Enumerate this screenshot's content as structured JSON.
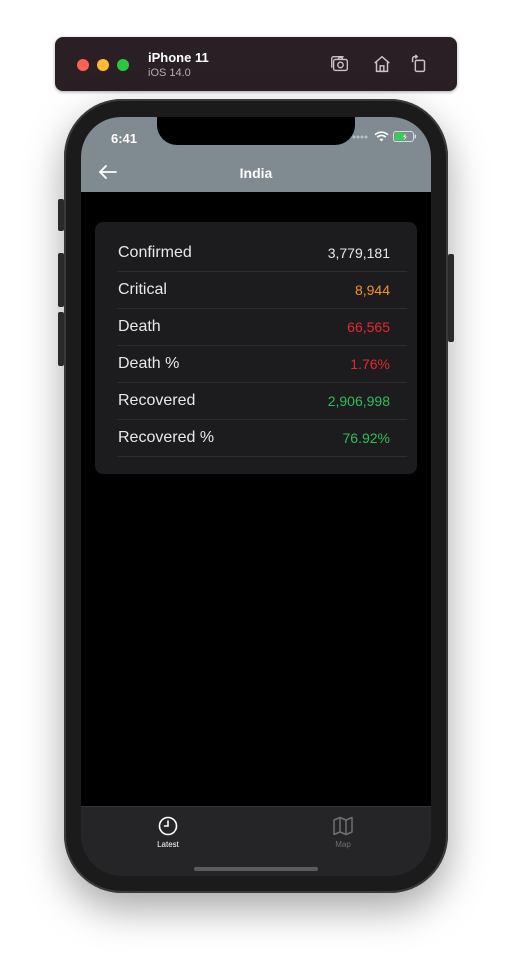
{
  "simulator": {
    "device_name": "iPhone 11",
    "os_version": "iOS 14.0",
    "buttons": [
      "screenshot-icon",
      "home-icon",
      "rotate-icon"
    ]
  },
  "status_bar": {
    "time": "6:41"
  },
  "nav": {
    "title": "India",
    "back_icon": "back-arrow-icon"
  },
  "stats": [
    {
      "label": "Confirmed",
      "value": "3,779,181",
      "color": "#e8e8ea"
    },
    {
      "label": "Critical",
      "value": "8,944",
      "color": "#f2932a"
    },
    {
      "label": "Death",
      "value": "66,565",
      "color": "#e5282e"
    },
    {
      "label": "Death %",
      "value": "1.76%",
      "color": "#e5282e"
    },
    {
      "label": "Recovered",
      "value": "2,906,998",
      "color": "#2fbe5b"
    },
    {
      "label": "Recovered %",
      "value": "76.92%",
      "color": "#2fbe5b"
    }
  ],
  "tabs": [
    {
      "label": "Latest",
      "icon": "clock-icon",
      "selected": true
    },
    {
      "label": "Map",
      "icon": "map-icon",
      "selected": false
    }
  ]
}
